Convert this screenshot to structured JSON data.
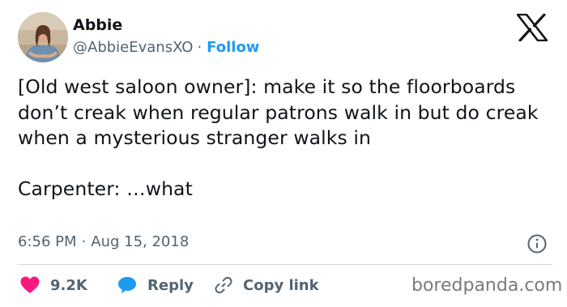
{
  "author": {
    "name": "Abbie",
    "handle": "@AbbieEvansXO",
    "separator": "·",
    "follow_label": "Follow"
  },
  "tweet": {
    "paragraph_1": "[Old west saloon owner]: make it so the floorboards don’t creak when regular patrons walk in but do creak when a mysterious stranger walks in",
    "paragraph_2": "Carpenter: …what",
    "time": "6:56 PM",
    "separator": "·",
    "date": "Aug 15, 2018"
  },
  "actions": {
    "likes_count": "9.2K",
    "reply_label": "Reply",
    "copy_link_label": "Copy link"
  },
  "watermark": "boredpanda.com",
  "icons": {
    "platform_logo": "x-logo-icon",
    "info": "info-icon",
    "like": "heart-icon",
    "reply": "speech-bubble-icon",
    "copy_link": "link-icon"
  },
  "colors": {
    "text_primary": "#0f1419",
    "text_secondary": "#536471",
    "link_blue": "#1d9bf0",
    "heart_red": "#f91880",
    "divider": "#cfd9de",
    "watermark": "#7a7a7a"
  }
}
